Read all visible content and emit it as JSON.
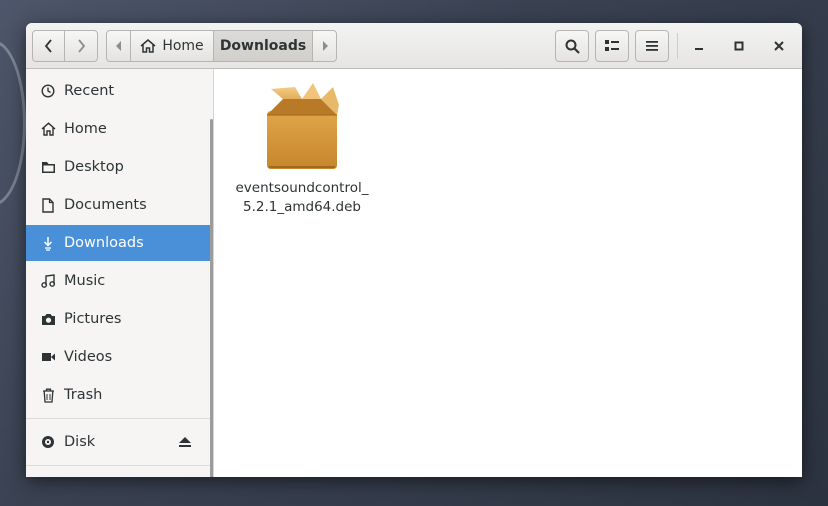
{
  "header": {
    "path": {
      "home_label": "Home",
      "current_label": "Downloads"
    },
    "icons": {
      "back": "chevron-left-icon",
      "forward": "chevron-right-icon",
      "search": "search-icon",
      "view": "list-view-icon",
      "menu": "hamburger-menu-icon",
      "minimize": "minimize-icon",
      "maximize": "maximize-icon",
      "close": "close-icon"
    }
  },
  "sidebar": {
    "items": [
      {
        "label": "Recent",
        "icon": "clock-icon"
      },
      {
        "label": "Home",
        "icon": "home-icon"
      },
      {
        "label": "Desktop",
        "icon": "folder-icon"
      },
      {
        "label": "Documents",
        "icon": "document-icon"
      },
      {
        "label": "Downloads",
        "icon": "download-icon",
        "active": true
      },
      {
        "label": "Music",
        "icon": "music-note-icon"
      },
      {
        "label": "Pictures",
        "icon": "camera-icon"
      },
      {
        "label": "Videos",
        "icon": "video-icon"
      },
      {
        "label": "Trash",
        "icon": "trash-icon"
      }
    ],
    "devices": [
      {
        "label": "Disk",
        "icon": "disk-icon"
      }
    ]
  },
  "content": {
    "files": [
      {
        "name": "eventsoundcontrol_5.2.1_amd64.deb",
        "icon": "package-box-icon"
      }
    ]
  },
  "colors": {
    "accent": "#4a90d9",
    "package": "#d99a3e"
  }
}
